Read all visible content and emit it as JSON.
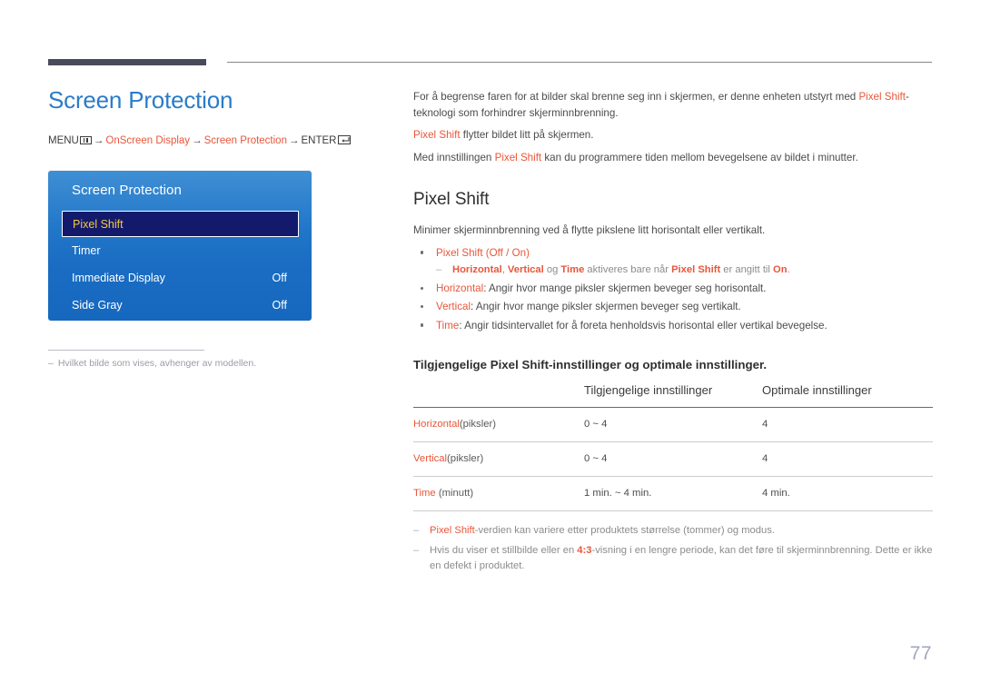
{
  "document": {
    "page_number": "77"
  },
  "left": {
    "title": "Screen Protection",
    "breadcrumb": {
      "menu_label": "MENU",
      "menu_icon": "menu-bars-icon",
      "arrow": "→",
      "item1": "OnScreen Display",
      "item2": "Screen Protection",
      "enter_label": "ENTER",
      "enter_icon": "enter-return-icon"
    },
    "osd": {
      "title": "Screen Protection",
      "rows": [
        {
          "label": "Pixel Shift",
          "value": "",
          "selected": true
        },
        {
          "label": "Timer",
          "value": "",
          "selected": false
        },
        {
          "label": "Immediate Display",
          "value": "Off",
          "selected": false
        },
        {
          "label": "Side Gray",
          "value": "Off",
          "selected": false
        }
      ]
    },
    "footnote": {
      "dash": "–",
      "text": "Hvilket bilde som vises, avhenger av modellen."
    }
  },
  "right": {
    "intro": {
      "p1_a": "For å begrense faren for at bilder skal brenne seg inn i skjermen, er denne enheten utstyrt med ",
      "p1_hl": "Pixel Shift",
      "p1_b": "-teknologi som forhindrer skjerminnbrenning.",
      "p2_hl": "Pixel Shift",
      "p2_a": " flytter bildet litt på skjermen.",
      "p3_a": "Med innstillingen ",
      "p3_hl": "Pixel Shift",
      "p3_b": " kan du programmere tiden mellom bevegelsene av bildet i minutter."
    },
    "section": {
      "title": "Pixel Shift",
      "lead": "Minimer skjerminnbrenning ved å flytte pikslene litt horisontalt eller vertikalt.",
      "bullet1": {
        "term": "Pixel Shift",
        "paren_open": " (",
        "opt1": "Off",
        "sep": " / ",
        "opt2": "On",
        "paren_close": ")"
      },
      "subnote1": {
        "dash": "–",
        "t1": "Horizontal",
        "c1": ", ",
        "t2": "Vertical",
        "mid": " og ",
        "t3": "Time",
        "t4": " aktiveres bare når ",
        "t5": "Pixel Shift",
        "t6": " er angitt til ",
        "t7": "On",
        "t8": "."
      },
      "bullet2": {
        "term": "Horizontal",
        "text": ": Angir hvor mange piksler skjermen beveger seg horisontalt."
      },
      "bullet3": {
        "term": "Vertical",
        "text": ": Angir hvor mange piksler skjermen beveger seg vertikalt."
      },
      "bullet4": {
        "term": "Time",
        "text": ": Angir tidsintervallet for å foreta henholdsvis horisontal eller vertikal bevegelse."
      }
    },
    "table_intro": "Tilgjengelige Pixel Shift-innstillinger og optimale innstillinger.",
    "table": {
      "headers": [
        "",
        "Tilgjengelige innstillinger",
        "Optimale innstillinger"
      ],
      "rows": [
        {
          "term": "Horizontal",
          "unit": "(piksler)",
          "available": "0 ~ 4",
          "optimal": "4"
        },
        {
          "term": "Vertical",
          "unit": "(piksler)",
          "available": "0 ~ 4",
          "optimal": "4"
        },
        {
          "term": "Time",
          "unit": " (minutt)",
          "available": "1 min. ~ 4 min.",
          "optimal": "4 min."
        }
      ]
    },
    "notes": {
      "note1": {
        "dash": "–",
        "hl": "Pixel Shift",
        "text": "-verdien kan variere etter produktets størrelse (tommer) og modus."
      },
      "note2": {
        "dash": "–",
        "a": "Hvis du viser et stillbilde eller en ",
        "hl": "4:3",
        "b": "-visning i en lengre periode, kan det føre til skjerminnbrenning. Dette er ikke en defekt i produktet."
      }
    }
  }
}
